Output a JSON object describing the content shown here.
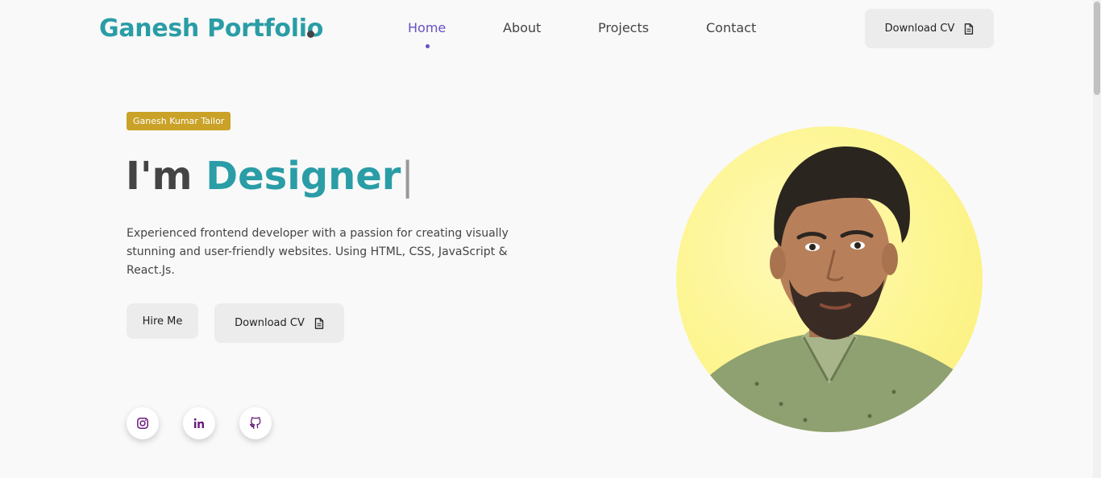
{
  "header": {
    "logo": "Ganesh Portfolio",
    "nav": [
      {
        "label": "Home",
        "active": true
      },
      {
        "label": "About",
        "active": false
      },
      {
        "label": "Projects",
        "active": false
      },
      {
        "label": "Contact",
        "active": false
      }
    ],
    "download_cv": "Download CV"
  },
  "hero": {
    "badge": "Ganesh Kumar Tailor",
    "headline_prefix": "I'm ",
    "headline_role": "Designer",
    "headline_cursor": "|",
    "description": "Experienced frontend developer with a passion for creating visually stunning and user-friendly websites. Using HTML, CSS, JavaScript & React.Js.",
    "hire_me": "Hire Me",
    "download_cv": "Download CV"
  },
  "socials": [
    {
      "icon": "instagram-icon"
    },
    {
      "icon": "linkedin-icon"
    },
    {
      "icon": "github-icon"
    }
  ],
  "colors": {
    "accent": "#2a9da6",
    "nav_active": "#6750c4",
    "badge": "#c9a227",
    "photo_bg": "#fdf58f"
  }
}
